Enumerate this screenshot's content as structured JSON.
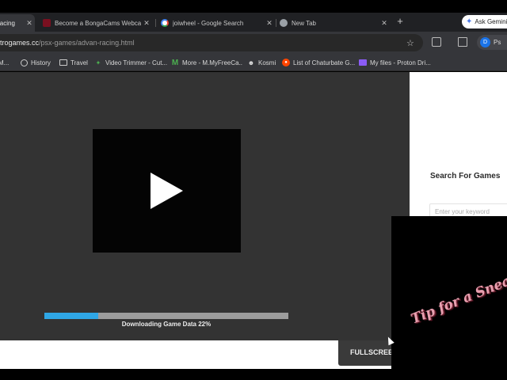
{
  "browser": {
    "tabs": [
      {
        "title": "Racing",
        "favicon_color": "#d44"
      },
      {
        "title": "Become a BongaCams Webcam",
        "favicon_color": "#7a1020"
      },
      {
        "title": "joiwheel - Google Search",
        "favicon_color": "#ffffff"
      },
      {
        "title": "New Tab",
        "favicon_color": "#9aa0a6"
      }
    ],
    "close_glyph": "✕",
    "new_tab_glyph": "+",
    "ask_gemini_label": "Ask Gemini",
    "url_host": "trogames.cc",
    "url_path": "/psx-games/advan-racing.html",
    "profile_initial": "D",
    "profile_label": "Ps",
    "bookmarks": [
      {
        "label": "M...",
        "icon": "gmail-icon"
      },
      {
        "label": "History",
        "icon": "history-icon"
      },
      {
        "label": "Travel",
        "icon": "folder-icon"
      },
      {
        "label": "Video Trimmer - Cut...",
        "icon": "video-trimmer-icon"
      },
      {
        "label": "More - M.MyFreeCa...",
        "icon": "m-icon"
      },
      {
        "label": "Kosmi",
        "icon": "kosmi-icon"
      },
      {
        "label": "List of Chaturbate G...",
        "icon": "reddit-icon"
      },
      {
        "label": "My files - Proton Dri...",
        "icon": "proton-folder-icon"
      }
    ]
  },
  "sidebar": {
    "search_title": "Search For Games",
    "search_placeholder": "Enter your keyword"
  },
  "game": {
    "progress_fraction": 0.22,
    "progress_text": "Downloading Game Data 22%",
    "fullscreen_label": "FULLSCREEN"
  },
  "ad": {
    "text": "Tip for a Sneak"
  },
  "colors": {
    "progress_fill": "#2fa7e6",
    "progress_track": "#9c9c9c",
    "game_bg": "#333333"
  }
}
